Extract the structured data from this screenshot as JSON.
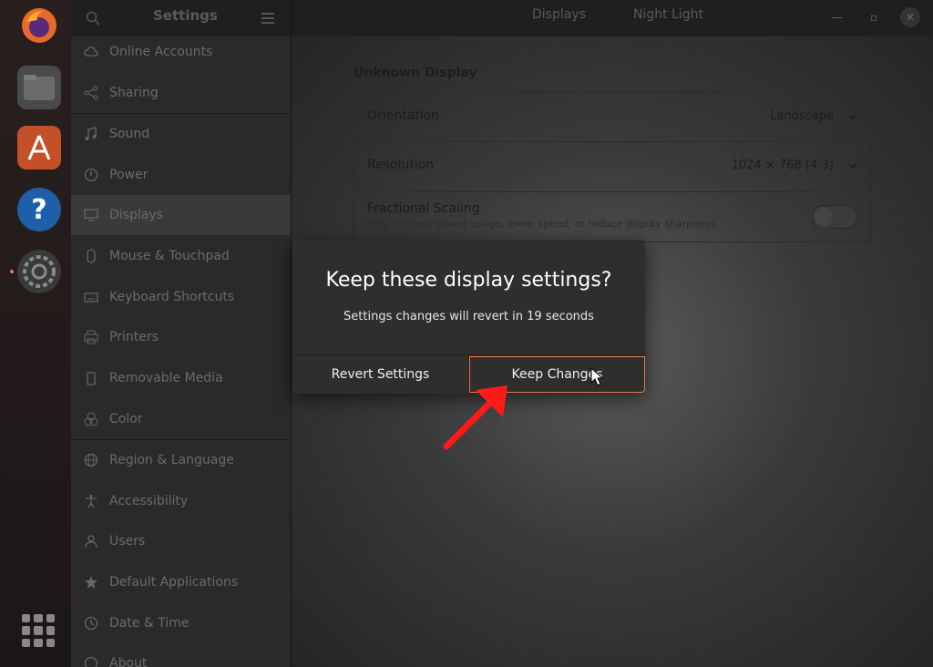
{
  "header": {
    "title": "Settings",
    "tabs": [
      "Displays",
      "Night Light"
    ]
  },
  "dock": {
    "items": [
      "firefox-icon",
      "files-icon",
      "software-icon",
      "help-icon",
      "settings-icon"
    ]
  },
  "sidebar": {
    "items": [
      {
        "label": "Online Accounts",
        "icon": "cloud-icon"
      },
      {
        "label": "Sharing",
        "icon": "share-icon"
      },
      {
        "label": "Sound",
        "icon": "music-note-icon"
      },
      {
        "label": "Power",
        "icon": "power-icon"
      },
      {
        "label": "Displays",
        "icon": "display-icon"
      },
      {
        "label": "Mouse & Touchpad",
        "icon": "mouse-icon"
      },
      {
        "label": "Keyboard Shortcuts",
        "icon": "keyboard-icon"
      },
      {
        "label": "Printers",
        "icon": "printer-icon"
      },
      {
        "label": "Removable Media",
        "icon": "usb-icon"
      },
      {
        "label": "Color",
        "icon": "color-icon"
      },
      {
        "label": "Region & Language",
        "icon": "globe-icon"
      },
      {
        "label": "Accessibility",
        "icon": "accessibility-icon"
      },
      {
        "label": "Users",
        "icon": "users-icon"
      },
      {
        "label": "Default Applications",
        "icon": "star-icon"
      },
      {
        "label": "Date & Time",
        "icon": "clock-icon"
      },
      {
        "label": "About",
        "icon": "info-icon"
      }
    ]
  },
  "display": {
    "section_title": "Unknown Display",
    "orientation_label": "Orientation",
    "orientation_value": "Landscape",
    "resolution_label": "Resolution",
    "resolution_value": "1024 × 768 (4:3)",
    "scaling_label": "Fractional Scaling",
    "scaling_sub": "May increase power usage, lower speed, or reduce display sharpness.",
    "scaling_enabled": false
  },
  "dialog": {
    "title": "Keep these display settings?",
    "message": "Settings changes will revert in 19 seconds",
    "revert_label": "Revert Settings",
    "keep_label": "Keep Changes"
  },
  "colors": {
    "accent": "#e9784a",
    "annotation": "#ff1a1a"
  }
}
